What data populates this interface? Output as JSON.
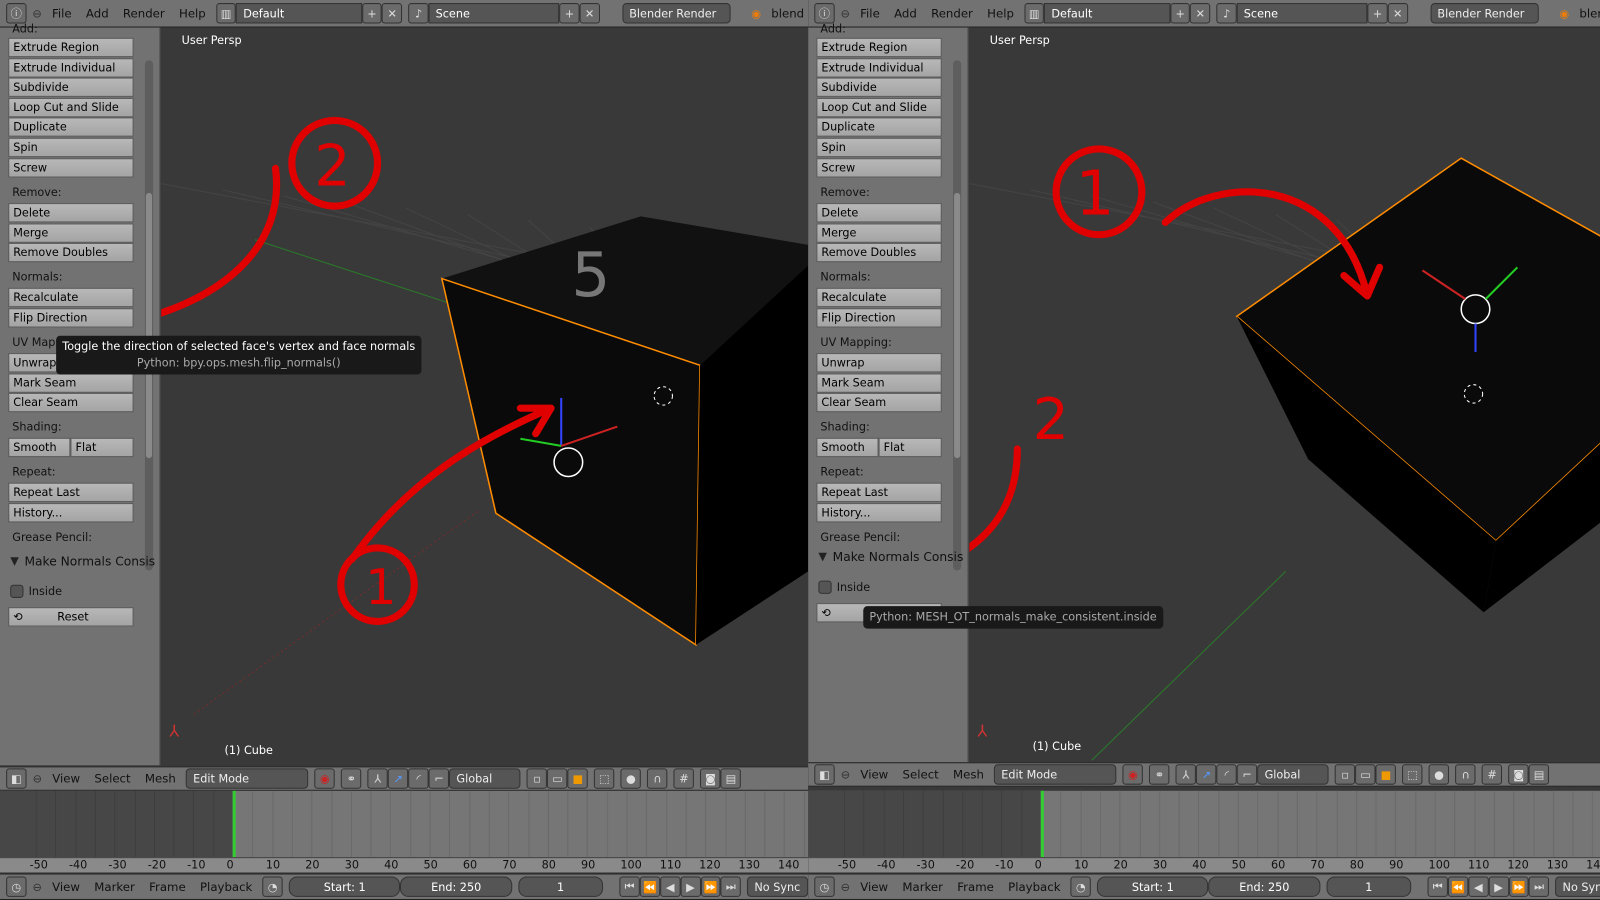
{
  "header": {
    "menus": [
      "File",
      "Add",
      "Render",
      "Help"
    ],
    "layout": "Default",
    "scene": "Scene",
    "engine": "Blender Render",
    "blend_label": "blend"
  },
  "shelf": {
    "add_label": "Add:",
    "add": [
      "Extrude Region",
      "Extrude Individual",
      "Subdivide",
      "Loop Cut and Slide",
      "Duplicate",
      "Spin",
      "Screw"
    ],
    "remove_label": "Remove:",
    "remove": [
      "Delete",
      "Merge",
      "Remove Doubles"
    ],
    "normals_label": "Normals:",
    "normals": [
      "Recalculate",
      "Flip Direction"
    ],
    "uv_label": "UV Mapping:",
    "uv": [
      "Unwrap",
      "Mark Seam",
      "Clear Seam"
    ],
    "shading_label": "Shading:",
    "smooth": "Smooth",
    "flat": "Flat",
    "repeat_label": "Repeat:",
    "repeat": [
      "Repeat Last",
      "History..."
    ],
    "grease_label": "Grease Pencil:",
    "operator": {
      "title": "Make Normals Consis",
      "inside": "Inside",
      "inside_checked": false,
      "reset": "Reset"
    }
  },
  "viewport": {
    "view_name": "User Persp",
    "object": "(1) Cube"
  },
  "left": {
    "tooltip": "Toggle the direction of selected face's vertex and face normals",
    "tooltip_python": "Python: bpy.ops.mesh.flip_normals()",
    "annotations": [
      "1",
      "2"
    ],
    "cube_top_text": "5"
  },
  "right": {
    "tooltip_python": "Python: MESH_OT_normals_make_consistent.inside",
    "annotations": [
      "1",
      "2"
    ]
  },
  "view3d_header": {
    "menus": [
      "View",
      "Select",
      "Mesh"
    ],
    "mode": "Edit Mode",
    "orientation": "Global"
  },
  "timeline": {
    "ticks": [
      "-50",
      "-40",
      "-30",
      "-20",
      "-10",
      "0",
      "10",
      "20",
      "30",
      "40",
      "50",
      "60",
      "70",
      "80",
      "90",
      "100",
      "110",
      "120",
      "130",
      "140"
    ],
    "current_frame_value": 0
  },
  "timeline_header": {
    "menus": [
      "View",
      "Marker",
      "Frame",
      "Playback"
    ],
    "start": "Start: 1",
    "end": "End: 250",
    "frame": "1",
    "sync": "No Sync"
  },
  "colors": {
    "annotation": "#e00000",
    "selection": "#ff8c00",
    "playhead": "#33cc33"
  }
}
